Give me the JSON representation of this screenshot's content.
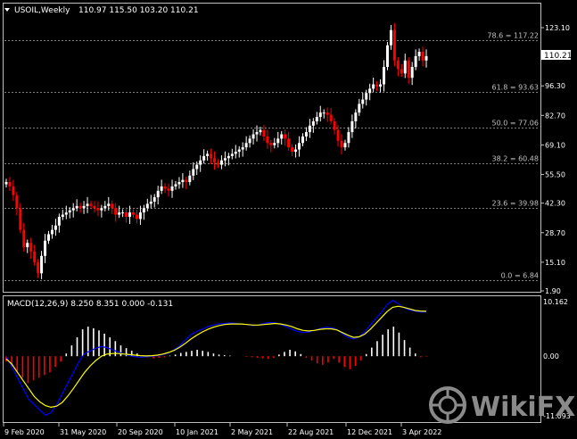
{
  "header": {
    "symbol_label": "USOIL,Weekly",
    "ohlc_label": "110.97 115.50 103.20 110.21",
    "collapse_icon": "triangle-down-icon"
  },
  "current_price": "110.21",
  "macd_header": "MACD(12,26,9) 8.250 8.351 0.000 -0.131",
  "watermark": {
    "text": "WikiFX",
    "icon": "wikifx-logo-icon"
  },
  "colors": {
    "background": "#000000",
    "border": "#c0c0c0",
    "bull": "#ffffff",
    "bear": "#ff0000",
    "fib": "#808080",
    "macd_line": "#0000ff",
    "signal_line": "#ffff00",
    "hist_pos": "#ffffff",
    "hist_neg": "#ff0000"
  },
  "chart_data": [
    {
      "type": "candlestick",
      "title": "USOIL,Weekly",
      "x_ticks": [
        "9 Feb 2020",
        "31 May 2020",
        "20 Sep 2020",
        "10 Jan 2021",
        "2 May 2021",
        "22 Aug 2021",
        "12 Dec 2021",
        "3 Apr 2022"
      ],
      "y_ticks": [
        123.1,
        110.21,
        96.3,
        82.7,
        69.1,
        55.5,
        42.3,
        28.7,
        15.1,
        1.9
      ],
      "y_tick_labels": [
        "123.10",
        "110.21",
        "96.30",
        "82.70",
        "69.10",
        "55.50",
        "42.30",
        "28.70",
        "15.10",
        "1.90"
      ],
      "ylim": [
        0,
        130
      ],
      "fibonacci": [
        {
          "label": "78.6 = 117.22",
          "value": 117.22
        },
        {
          "label": "61.8 = 93.63",
          "value": 93.63
        },
        {
          "label": "50.0 = 77.06",
          "value": 77.06
        },
        {
          "label": "38.2 = 60.48",
          "value": 60.48
        },
        {
          "label": "23.6 = 39.98",
          "value": 39.98
        },
        {
          "label": "0.0 = 6.84",
          "value": 6.84
        }
      ],
      "close_path": [
        52,
        50,
        46,
        40,
        30,
        22,
        24,
        20,
        15,
        10,
        18,
        25,
        28,
        30,
        32,
        36,
        37,
        38,
        39,
        40,
        41,
        40,
        41,
        42,
        41,
        40,
        39,
        40,
        41,
        42,
        40,
        37,
        38,
        38,
        36,
        38,
        37,
        35,
        38,
        40,
        42,
        43,
        45,
        48,
        50,
        49,
        48,
        50,
        51,
        52,
        53,
        52,
        55,
        58,
        60,
        62,
        64,
        65,
        63,
        61,
        60,
        62,
        63,
        64,
        65,
        66,
        67,
        68,
        70,
        72,
        74,
        75,
        76,
        73,
        70,
        69,
        70,
        72,
        74,
        72,
        68,
        66,
        67,
        70,
        73,
        75,
        78,
        80,
        82,
        84,
        84,
        83,
        80,
        76,
        71,
        68,
        70,
        75,
        80,
        84,
        88,
        90,
        93,
        95,
        97,
        96,
        97,
        105,
        115,
        122,
        108,
        104,
        102,
        108,
        100,
        105,
        110,
        112,
        108,
        110
      ]
    },
    {
      "type": "line",
      "title": "MACD(12,26,9)",
      "y_ticks": [
        10.162,
        0.0,
        -11.093
      ],
      "y_tick_labels": [
        "10.162",
        "0.00",
        "-11.093"
      ],
      "ylim": [
        -12,
        11
      ],
      "series": [
        {
          "name": "MACD",
          "values": [
            0,
            -2,
            -4,
            -6,
            -8,
            -9,
            -10,
            -11,
            -10.5,
            -9,
            -7,
            -5,
            -3,
            -1,
            0.5,
            1,
            1.5,
            1.8,
            1.6,
            1.2,
            0.8,
            0.4,
            0.1,
            -0.1,
            -0.2,
            -0.1,
            0,
            0.1,
            0.3,
            0.6,
            1.2,
            2,
            3,
            4,
            4.6,
            5,
            5.5,
            5.8,
            6,
            6.1,
            6.2,
            6.1,
            6,
            5.9,
            5.7,
            5.8,
            6.1,
            6.3,
            6.2,
            5.9,
            5.5,
            5,
            4.6,
            4.4,
            4.5,
            4.8,
            5.1,
            5.4,
            5.3,
            5,
            4.2,
            3.5,
            3.2,
            3.6,
            4.5,
            5.8,
            7,
            8.2,
            9.6,
            10.4,
            9.8,
            9,
            8.6,
            8.4,
            8.2,
            8.25
          ]
        },
        {
          "name": "Signal",
          "values": [
            -0.5,
            -1.5,
            -3,
            -4.5,
            -6,
            -7.5,
            -8.5,
            -9.2,
            -9.5,
            -9.3,
            -8.6,
            -7.4,
            -6,
            -4.5,
            -3,
            -1.8,
            -0.8,
            0,
            0.4,
            0.5,
            0.5,
            0.4,
            0.3,
            0.2,
            0.1,
            0.05,
            0.1,
            0.2,
            0.4,
            0.7,
            1.1,
            1.7,
            2.4,
            3.2,
            3.9,
            4.5,
            5,
            5.4,
            5.7,
            5.9,
            6,
            6,
            6,
            5.9,
            5.8,
            5.8,
            5.9,
            6,
            6.1,
            6,
            5.8,
            5.5,
            5.1,
            4.8,
            4.7,
            4.8,
            5,
            5.1,
            5.1,
            4.9,
            4.4,
            3.9,
            3.5,
            3.6,
            4.1,
            5,
            6.1,
            7.2,
            8.3,
            9.1,
            9.3,
            9.1,
            8.8,
            8.5,
            8.4,
            8.35
          ]
        },
        {
          "name": "Histogram",
          "values": [
            -1,
            -2,
            -3,
            -4,
            -5,
            -4.5,
            -4,
            -3.5,
            -3,
            -2,
            -1,
            0.5,
            2,
            3.5,
            5,
            5.5,
            5.2,
            4.8,
            4.2,
            3.5,
            2.8,
            2,
            1.5,
            1,
            0.5,
            0,
            -0.2,
            -0.4,
            -0.3,
            -0.2,
            0.1,
            0.3,
            0.6,
            0.8,
            1,
            1.2,
            1,
            0.8,
            0.5,
            0.3,
            0.2,
            0.1,
            0,
            0,
            -0.1,
            -0.2,
            -0.3,
            -0.4,
            -0.5,
            -0.3,
            0.3,
            0.8,
            1.2,
            0.9,
            0.4,
            -0.3,
            -0.8,
            -1.3,
            -1.6,
            -1.2,
            -0.5,
            -1.2,
            -2,
            -2.4,
            -1.8,
            -0.8,
            0.4,
            1.6,
            2.8,
            4,
            5,
            5.5,
            4.4,
            3,
            1.6,
            0.5,
            -0.2,
            -0.1
          ]
        }
      ]
    }
  ]
}
